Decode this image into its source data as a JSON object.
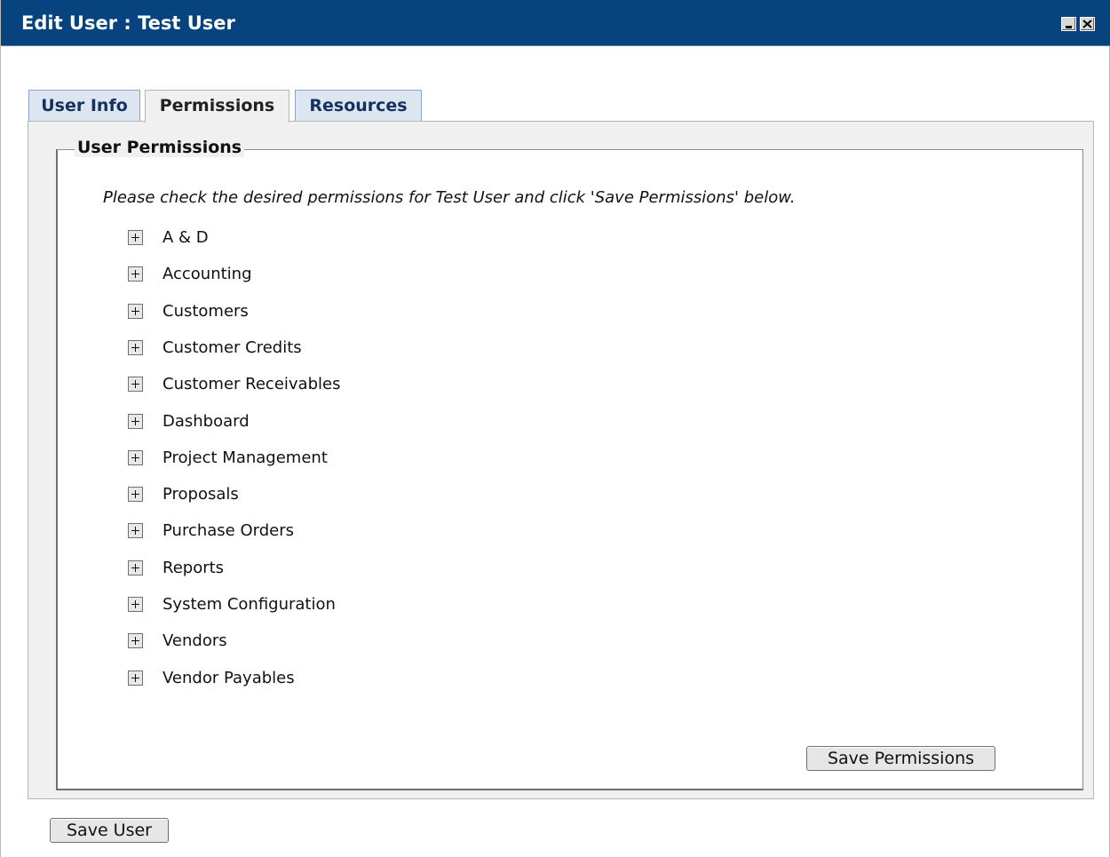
{
  "window": {
    "title": "Edit User : Test User"
  },
  "tabs": [
    {
      "label": "User Info",
      "active": false
    },
    {
      "label": "Permissions",
      "active": true
    },
    {
      "label": "Resources",
      "active": false
    }
  ],
  "permissions": {
    "legend": "User Permissions",
    "instructions": "Please check the desired permissions for Test User and click 'Save Permissions' below.",
    "items": [
      "A & D",
      "Accounting",
      "Customers",
      "Customer Credits",
      "Customer Receivables",
      "Dashboard",
      "Project Management",
      "Proposals",
      "Purchase Orders",
      "Reports",
      "System Configuration",
      "Vendors",
      "Vendor Payables"
    ],
    "save_label": "Save Permissions"
  },
  "footer": {
    "save_user_label": "Save User"
  },
  "colors": {
    "titlebar": "#06437f",
    "tab_inactive_text": "#16325c",
    "panel_bg": "#f0f0f0"
  },
  "icons": {
    "expander": "plus-box-icon",
    "minimize": "minimize-icon",
    "close": "close-icon"
  }
}
